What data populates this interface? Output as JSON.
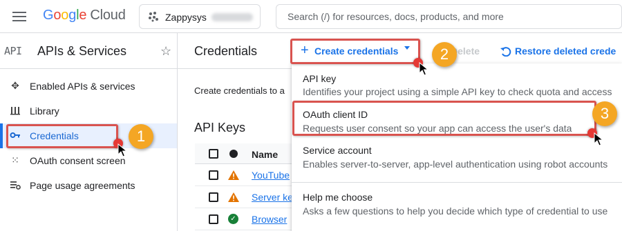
{
  "topbar": {
    "logo": {
      "g1": "G",
      "g2": "o",
      "g3": "o",
      "g4": "g",
      "g5": "l",
      "g6": "e",
      "cloud": "Cloud"
    },
    "project_name": "Zappysys",
    "search_placeholder": "Search (/) for resources, docs, products, and more"
  },
  "sidebar": {
    "badge": "API",
    "title": "APIs & Services",
    "items": [
      {
        "label": "Enabled APIs & services",
        "icon": "diamond-arrows-icon",
        "active": false
      },
      {
        "label": "Library",
        "icon": "library-icon",
        "active": false
      },
      {
        "label": "Credentials",
        "icon": "key-icon",
        "active": true
      },
      {
        "label": "OAuth consent screen",
        "icon": "consent-icon",
        "active": false
      },
      {
        "label": "Page usage agreements",
        "icon": "settings-list-icon",
        "active": false
      }
    ]
  },
  "main": {
    "title": "Credentials",
    "create_label": "Create credentials",
    "delete_label": "Delete",
    "restore_label": "Restore deleted crede",
    "intro": "Create credentials to a",
    "section_title": "API Keys",
    "table": {
      "header_name": "Name",
      "rows": [
        {
          "name": "YouTube",
          "status": "warning"
        },
        {
          "name": "Server ke",
          "status": "warning"
        },
        {
          "name": "Browser",
          "status": "ok"
        }
      ]
    }
  },
  "menu": {
    "items": [
      {
        "title": "API key",
        "desc": "Identifies your project using a simple API key to check quota and access"
      },
      {
        "title": "OAuth client ID",
        "desc": "Requests user consent so your app can access the user's data"
      },
      {
        "title": "Service account",
        "desc": "Enables server-to-server, app-level authentication using robot accounts"
      },
      {
        "title": "Help me choose",
        "desc": "Asks a few questions to help you decide which type of credential to use"
      }
    ]
  },
  "annotations": {
    "steps": [
      "1",
      "2",
      "3"
    ],
    "highlight_color": "#d9534f",
    "step_color": "#f4a624"
  },
  "colors": {
    "accent": "#1a73e8",
    "active_bg": "#e8f0fe",
    "warning": "#e37400",
    "ok": "#188038"
  }
}
